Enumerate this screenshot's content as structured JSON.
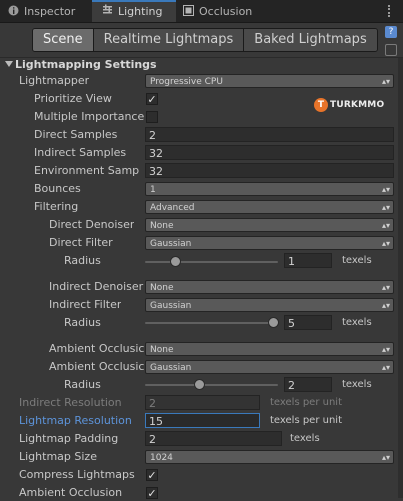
{
  "tabs": [
    {
      "label": "Inspector",
      "icon": "info-icon",
      "active": false
    },
    {
      "label": "Lighting",
      "icon": "lighting-icon",
      "active": true
    },
    {
      "label": "Occlusion",
      "icon": "occlusion-icon",
      "active": false
    }
  ],
  "subtabs": [
    {
      "label": "Scene",
      "active": true
    },
    {
      "label": "Realtime Lightmaps",
      "active": false
    },
    {
      "label": "Baked Lightmaps",
      "active": false
    }
  ],
  "side_icon": "?",
  "section": {
    "title": "Lightmapping Settings"
  },
  "watermark": {
    "text": "TURKMMO",
    "mark": "T"
  },
  "settings": {
    "lightmapper": {
      "label": "Lightmapper",
      "value": "Progressive CPU"
    },
    "prioritize_view": {
      "label": "Prioritize View",
      "checked": true
    },
    "multiple_importance": {
      "label": "Multiple Importance",
      "checked": false
    },
    "direct_samples": {
      "label": "Direct Samples",
      "value": "2"
    },
    "indirect_samples": {
      "label": "Indirect Samples",
      "value": "32"
    },
    "environment_samples": {
      "label": "Environment Samp",
      "value": "32"
    },
    "bounces": {
      "label": "Bounces",
      "value": "1"
    },
    "filtering": {
      "label": "Filtering",
      "value": "Advanced"
    },
    "direct_denoiser": {
      "label": "Direct Denoiser",
      "value": "None"
    },
    "direct_filter": {
      "label": "Direct Filter",
      "value": "Gaussian"
    },
    "direct_radius": {
      "label": "Radius",
      "value": "1",
      "unit": "texels",
      "level": 0.2
    },
    "indirect_denoiser": {
      "label": "Indirect Denoiser",
      "value": "None"
    },
    "indirect_filter": {
      "label": "Indirect Filter",
      "value": "Gaussian"
    },
    "indirect_radius": {
      "label": "Radius",
      "value": "5",
      "unit": "texels",
      "level": 1.0
    },
    "ambient_denoiser": {
      "label": "Ambient Occlusic",
      "value": "None"
    },
    "ambient_filter": {
      "label": "Ambient Occlusic",
      "value": "Gaussian"
    },
    "ambient_radius": {
      "label": "Radius",
      "value": "2",
      "unit": "texels",
      "level": 0.4
    },
    "indirect_resolution": {
      "label": "Indirect Resolution",
      "value": "2",
      "unit": "texels per unit"
    },
    "lightmap_resolution": {
      "label": "Lightmap Resolution",
      "value": "15",
      "unit": "texels per unit"
    },
    "lightmap_padding": {
      "label": "Lightmap Padding",
      "value": "2",
      "unit": "texels"
    },
    "lightmap_size": {
      "label": "Lightmap Size",
      "value": "1024"
    },
    "compress_lightmaps": {
      "label": "Compress Lightmaps",
      "checked": true
    },
    "ambient_occlusion": {
      "label": "Ambient Occlusion",
      "checked": true
    }
  },
  "colors": {
    "focus_blue": "#3a79bb",
    "label_focus": "#5d94da",
    "background": "#383838",
    "logo_orange": "#e8742a"
  }
}
